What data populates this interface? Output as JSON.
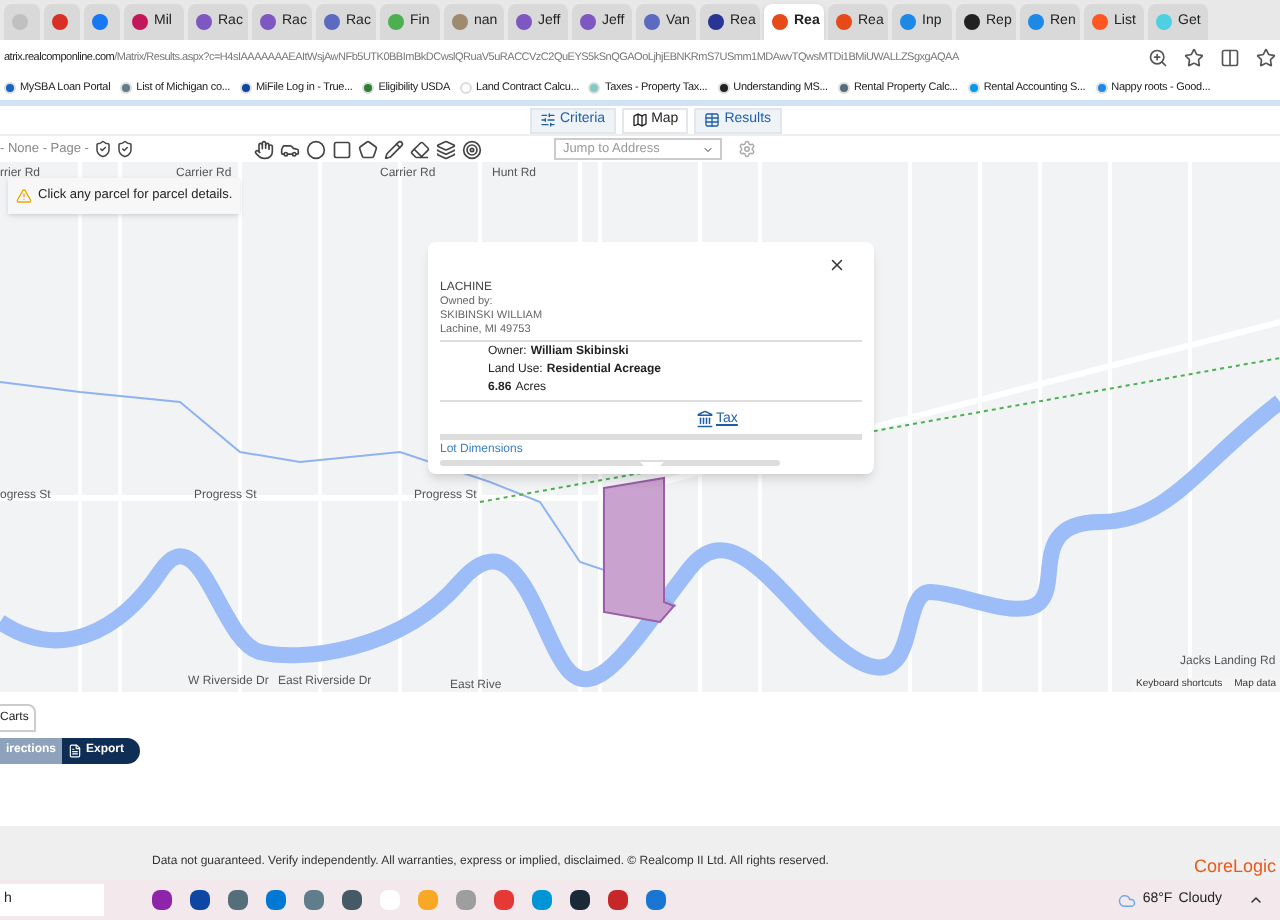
{
  "browser": {
    "tabs": [
      {
        "color": "#c0c0c0",
        "selected": false
      },
      {
        "color": "#d93025",
        "selected": false
      },
      {
        "color": "#1877f2",
        "selected": false
      },
      {
        "label": "Mil",
        "color": "#c2185b",
        "selected": false
      },
      {
        "label": "Rac",
        "color": "#7e57c2",
        "selected": false
      },
      {
        "label": "Rac",
        "color": "#7e57c2",
        "selected": false
      },
      {
        "label": "Rac",
        "color": "#5c6bc0",
        "selected": false
      },
      {
        "label": "Fin",
        "color": "#4caf50",
        "selected": false
      },
      {
        "label": "nan",
        "color": "#9e8a6e",
        "selected": false
      },
      {
        "label": "Jeff",
        "color": "#7e57c2",
        "selected": false
      },
      {
        "label": "Jeff",
        "color": "#7e57c2",
        "selected": false
      },
      {
        "label": "Van",
        "color": "#5c6bc0",
        "selected": false
      },
      {
        "label": "Rea",
        "color": "#283593",
        "selected": false
      },
      {
        "label": "Rea",
        "color": "#e64a19",
        "selected": true
      },
      {
        "label": "Rea",
        "color": "#e64a19",
        "selected": false
      },
      {
        "label": "Inp",
        "color": "#1e88e5",
        "selected": false
      },
      {
        "label": "Rep",
        "color": "#212121",
        "selected": false
      },
      {
        "label": "Ren",
        "color": "#1e88e5",
        "selected": false
      },
      {
        "label": "List",
        "color": "#ff5722",
        "selected": false
      },
      {
        "label": "Get",
        "color": "#4dd0e1",
        "selected": false
      }
    ],
    "url_host": "atrix.realcomponline.com",
    "url_path": "/Matrix/Results.aspx?c=H4sIAAAAAAAEAItWsjAwNFb5UTK0BBImBkDCwslQRuaV5uRACCVzC2QuEYS5kSnQGAOoLjhjEBNKRmS7USmm1MDAwvTQwsMTDi1BMiUWALLZSgxgAQAA",
    "bookmarks": [
      {
        "label": "MySBA Loan Portal",
        "color": "#1565c0"
      },
      {
        "label": "List of Michigan co...",
        "color": "#607d8b"
      },
      {
        "label": "MiFile Log in - True...",
        "color": "#0d47a1"
      },
      {
        "label": "Eligibility USDA",
        "color": "#2e7d32"
      },
      {
        "label": "Land Contract Calcu...",
        "color": "#ffffff"
      },
      {
        "label": "Taxes - Property Tax...",
        "color": "#80cbc4"
      },
      {
        "label": "Understanding MS...",
        "color": "#212121"
      },
      {
        "label": "Rental Property Calc...",
        "color": "#546e7a"
      },
      {
        "label": "Rental Accounting S...",
        "color": "#039be5"
      },
      {
        "label": "Nappy roots - Good...",
        "color": "#1e88e5"
      }
    ]
  },
  "view_tabs": [
    {
      "kind": "criteria",
      "label": "Criteria",
      "selected": false
    },
    {
      "kind": "map",
      "label": "Map",
      "selected": true
    },
    {
      "kind": "results",
      "label": "Results",
      "selected": false
    }
  ],
  "toolbar": {
    "select_label": "- None - Page -",
    "jump_placeholder": "Jump to Address"
  },
  "map": {
    "notice": "Click any parcel for parcel details.",
    "labels": [
      "rrier Rd",
      "Carrier Rd",
      "Carrier Rd",
      "Hunt Rd",
      "ogress St",
      "Progress St",
      "Progress St",
      "W Riverside Dr",
      "East Riverside Dr",
      "East Rive",
      "Jacks Landing Rd"
    ],
    "popup": {
      "place": "LACHINE",
      "owned_by": "Owned by:",
      "owner_name": "SKIBINSKI WILLIAM",
      "address": "Lachine, MI 49753",
      "owner_label": "Owner:",
      "owner": "William Skibinski",
      "land_use_label": "Land Use:",
      "land_use": "Residential Acreage",
      "acres": "6.86",
      "acres_unit": "Acres",
      "tax_link": "Tax",
      "lot_link": "Lot Dimensions"
    },
    "attribution": [
      "Keyboard shortcuts",
      "Map data"
    ]
  },
  "bottom": {
    "tab": "Carts",
    "buttons": [
      {
        "kind": "secondary",
        "label": "irections"
      },
      {
        "kind": "primary",
        "label": "Export"
      }
    ]
  },
  "footer": {
    "disclaimer": "Data not guaranteed. Verify independently. All warranties, express or implied, disclaimed. © Realcomp II Ltd. All rights reserved.",
    "logo": "CoreLogic"
  },
  "taskbar": {
    "search": "h",
    "apps": [
      {
        "color": "#8e24aa"
      },
      {
        "color": "#0d47a1"
      },
      {
        "color": "#546e7a"
      },
      {
        "color": "#0078d4"
      },
      {
        "color": "#607d8b"
      },
      {
        "color": "#455a64"
      },
      {
        "color": "#ffffff"
      },
      {
        "color": "#f9a825"
      },
      {
        "color": "#9e9e9e"
      },
      {
        "color": "#e53935"
      },
      {
        "color": "#0096d6"
      },
      {
        "color": "#1b2838"
      },
      {
        "color": "#c62828"
      },
      {
        "color": "#1976d2"
      }
    ],
    "weather": "68°F",
    "condition": "Cloudy"
  }
}
